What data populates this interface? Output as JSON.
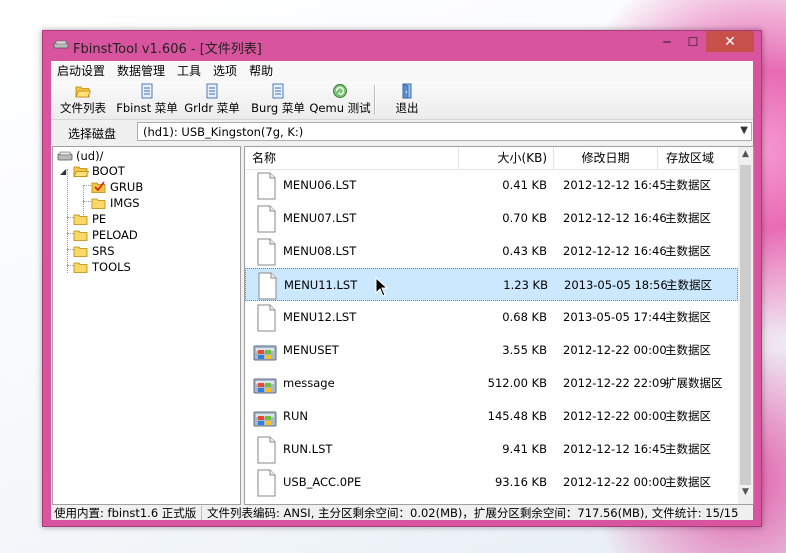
{
  "window": {
    "title": "FbinstTool v1.606 - [文件列表]",
    "min_symbol": "─",
    "max_symbol": "☐",
    "close_symbol": "✕"
  },
  "menubar": {
    "items": [
      "启动设置",
      "数据管理",
      "工具",
      "选项",
      "帮助"
    ]
  },
  "toolbar": {
    "items": [
      {
        "label": "文件列表",
        "icon": "folder-open-icon"
      },
      {
        "label": "Fbinst 菜单",
        "icon": "menu-document-icon"
      },
      {
        "label": "Grldr 菜单",
        "icon": "menu-document-icon"
      },
      {
        "label": "Burg 菜单",
        "icon": "menu-document-icon"
      },
      {
        "label": "Qemu 测试",
        "icon": "qemu-disc-icon"
      },
      {
        "label": "退出",
        "icon": "exit-door-icon"
      }
    ]
  },
  "diskbar": {
    "label": "选择磁盘",
    "selected": "(hd1): USB_Kingston(7g, K:)"
  },
  "tree": {
    "root": "(ud)/",
    "boot": "BOOT",
    "grub": "GRUB",
    "imgs": "IMGS",
    "pe": "PE",
    "peload": "PELOAD",
    "srs": "SRS",
    "tools": "TOOLS",
    "expander_open": "◢"
  },
  "list": {
    "headers": {
      "name": "名称",
      "size": "大小(KB)",
      "date": "修改日期",
      "area": "存放区域"
    },
    "rows": [
      {
        "name": "MENU06.LST",
        "size": "0.41 KB",
        "date": "2012-12-12 16:45",
        "area": "主数据区",
        "icon": "document-icon"
      },
      {
        "name": "MENU07.LST",
        "size": "0.70 KB",
        "date": "2012-12-12 16:46",
        "area": "主数据区",
        "icon": "document-icon"
      },
      {
        "name": "MENU08.LST",
        "size": "0.43 KB",
        "date": "2012-12-12 16:46",
        "area": "主数据区",
        "icon": "document-icon"
      },
      {
        "name": "MENU11.LST",
        "size": "1.23 KB",
        "date": "2013-05-05 18:56",
        "area": "主数据区",
        "icon": "document-icon",
        "selected": true
      },
      {
        "name": "MENU12.LST",
        "size": "0.68 KB",
        "date": "2013-05-05 17:44",
        "area": "主数据区",
        "icon": "document-icon"
      },
      {
        "name": "MENUSET",
        "size": "3.55 KB",
        "date": "2012-12-22 00:00",
        "area": "主数据区",
        "icon": "windows-app-icon"
      },
      {
        "name": "message",
        "size": "512.00 KB",
        "date": "2012-12-22 22:09",
        "area": "扩展数据区",
        "icon": "windows-app-icon"
      },
      {
        "name": "RUN",
        "size": "145.48 KB",
        "date": "2012-12-22 00:00",
        "area": "主数据区",
        "icon": "windows-app-icon"
      },
      {
        "name": "RUN.LST",
        "size": "9.41 KB",
        "date": "2012-12-12 16:45",
        "area": "主数据区",
        "icon": "document-icon"
      },
      {
        "name": "USB_ACC.0PE",
        "size": "93.16 KB",
        "date": "2012-12-22 00:00",
        "area": "主数据区",
        "icon": "document-icon"
      }
    ]
  },
  "scroll": {
    "up": "▲",
    "down": "▼"
  },
  "status": {
    "left": "使用内置: fbinst1.6 正式版",
    "right": "文件列表编码: ANSI, 主分区剩余空间：0.02(MB)，扩展分区剩余空间：717.56(MB), 文件统计: 15/15"
  },
  "colors": {
    "frame": "#d8549e",
    "selection": "#cce8ff",
    "close_button": "#c7504a"
  }
}
